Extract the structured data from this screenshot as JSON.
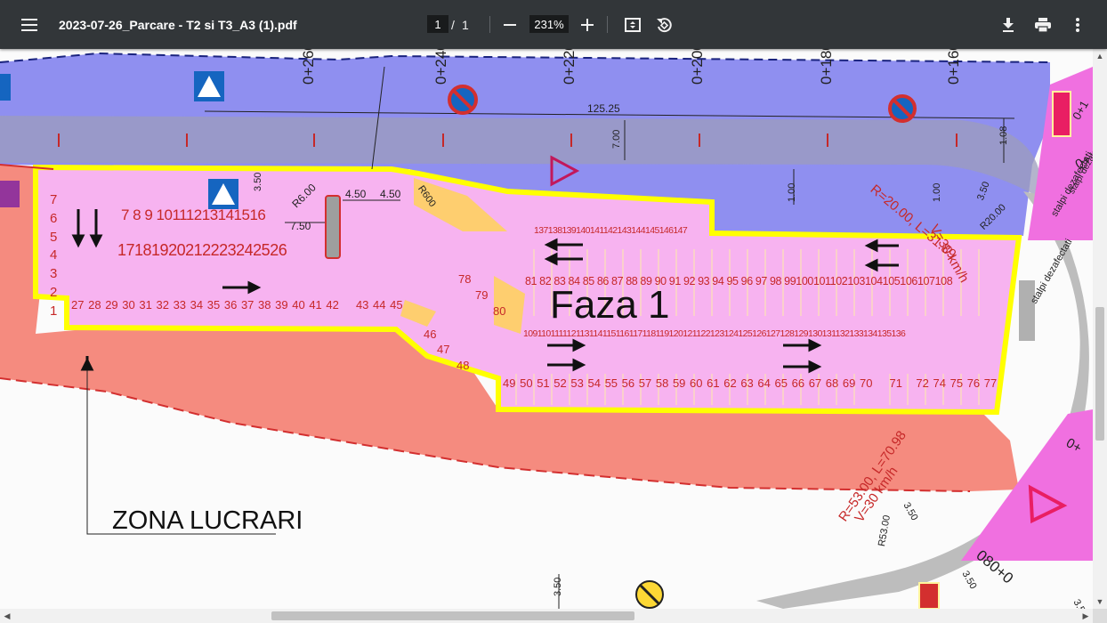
{
  "toolbar": {
    "menu_icon": "hamburger-menu-icon",
    "file_title": "2023-07-26_Parcare - T2 si T3_A3 (1).pdf",
    "current_page": "1",
    "page_separator": "/",
    "total_pages": "1",
    "zoom_out_icon": "minus-icon",
    "zoom_value": "231%",
    "zoom_in_icon": "plus-icon",
    "fit_icon": "fit-to-page-icon",
    "rotate_icon": "rotate-counterclockwise-icon",
    "download_icon": "download-icon",
    "print_icon": "print-icon",
    "more_icon": "more-vertical-icon"
  },
  "colors": {
    "toolbar_bg": "#323639",
    "blue_zone": "#8f8ff0",
    "red_zone": "#f58b7f",
    "pink_zone": "#f7b3f0",
    "magenta_zone": "#f070e0",
    "yellow_border": "#ffff00",
    "marking_red": "#c62828",
    "road_gray": "#b0b0b0"
  },
  "drawing": {
    "chainage": [
      "0+260",
      "0+240",
      "0+220",
      "0+200",
      "0+180",
      "0+160",
      "0+1",
      "0+",
      "0+",
      "080+0"
    ],
    "dimensions": {
      "d_125_25": "125.25",
      "d_7_00": "7.00",
      "d_1_08": "1.08",
      "d_1_00a": "1.00",
      "d_1_00b": "1.00",
      "d_3_50a": "3.50",
      "d_3_50b": "3.50",
      "d_3_50c": "3.50",
      "d_3_50d": "3.50",
      "d_3_50e": "3.50",
      "d_3_50f": "3.50",
      "d_4_50a": "4.50",
      "d_4_50b": "4.50",
      "d_7_50": "7.50",
      "r_6_00": "R6.00",
      "r_600": "R600",
      "r_20_00": "R20.00",
      "r_53_00": "R53.00",
      "curve1_a": "R=53.00, L=70.98",
      "curve1_b": "V=30 km/h",
      "curve2_a": "R=20.00, L=31.89",
      "curve2_b": "V=30 km/h",
      "stalpi1": "stalpi dezafectati",
      "stalpi2": "stalpi dezafectati",
      "stalpi3": "stalpi dezafe"
    },
    "phase_label": "Faza 1",
    "zone_label": "ZONA LUCRARI",
    "spots": {
      "col_1_7": [
        "7",
        "6",
        "5",
        "4",
        "3",
        "2",
        "1"
      ],
      "row_7_16": "7 8 9 10111213141516",
      "row_17_26": "17181920212223242526",
      "row_27_45": [
        "27",
        "28",
        "29",
        "30",
        "31",
        "32",
        "33",
        "34",
        "35",
        "36",
        "37",
        "38",
        "39",
        "40",
        "41",
        "42",
        "43",
        "44",
        "45"
      ],
      "s46": "46",
      "s47": "47",
      "s48": "48",
      "s78": "78",
      "s79": "79",
      "s80": "80",
      "row_49_77": [
        "49",
        "50",
        "51",
        "52",
        "53",
        "54",
        "55",
        "56",
        "57",
        "58",
        "59",
        "60",
        "61",
        "62",
        "63",
        "64",
        "65",
        "66",
        "67",
        "68",
        "69",
        "70",
        "71",
        "72",
        "74",
        "75",
        "76",
        "77"
      ],
      "row_81_108": "81 82 83 84 85 86 87 88 89 90 91 92 93 94 95 96 97 98 99100101102103104105106107108",
      "row_109_136": "109110111112113114115116117118119120121122123124125126127128129130131132133134135136",
      "row_137_147": "137138139140141142143144145146147"
    }
  }
}
